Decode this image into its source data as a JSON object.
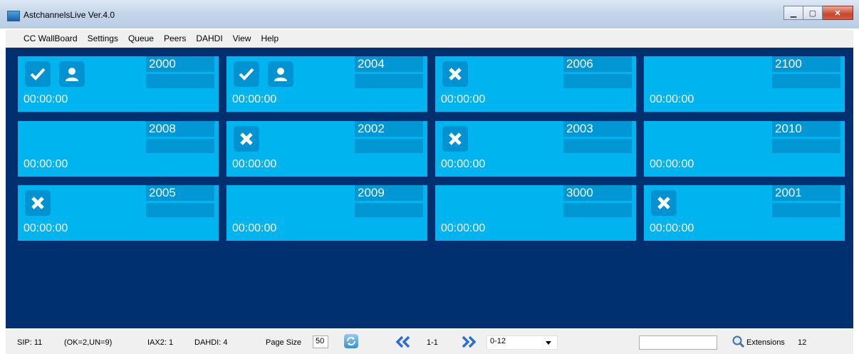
{
  "window": {
    "title": "AstchannelsLive Ver.4.0",
    "icon": "app-icon"
  },
  "menu": {
    "items": [
      "CC WallBoard",
      "Settings",
      "Queue",
      "Peers",
      "DAHDI",
      "View",
      "Help"
    ]
  },
  "tiles": [
    {
      "ext": "2000",
      "time": "00:00:00",
      "icons": [
        "check-icon",
        "user-icon"
      ]
    },
    {
      "ext": "2004",
      "time": "00:00:00",
      "icons": [
        "check-icon",
        "user-icon"
      ]
    },
    {
      "ext": "2006",
      "time": "00:00:00",
      "icons": [
        "x-icon"
      ]
    },
    {
      "ext": "2100",
      "time": "00:00:00",
      "icons": []
    },
    {
      "ext": "2008",
      "time": "00:00:00",
      "icons": []
    },
    {
      "ext": "2002",
      "time": "00:00:00",
      "icons": [
        "x-icon"
      ]
    },
    {
      "ext": "2003",
      "time": "00:00:00",
      "icons": [
        "x-icon"
      ]
    },
    {
      "ext": "2010",
      "time": "00:00:00",
      "icons": []
    },
    {
      "ext": "2005",
      "time": "00:00:00",
      "icons": [
        "x-icon"
      ]
    },
    {
      "ext": "2009",
      "time": "00:00:00",
      "icons": []
    },
    {
      "ext": "3000",
      "time": "00:00:00",
      "icons": []
    },
    {
      "ext": "2001",
      "time": "00:00:00",
      "icons": [
        "x-icon"
      ]
    }
  ],
  "status": {
    "sip": "SIP: 11",
    "ok_un": "(OK=2,UN=9)",
    "iax2": "IAX2: 1",
    "dahdi": "DAHDI: 4",
    "page_size_label": "Page Size",
    "page_size_value": "50",
    "page_range": "1-1",
    "range_select": "0-12",
    "search_value": "",
    "extensions_label": "Extensions",
    "extensions_count": "12"
  },
  "colors": {
    "board_bg": "#003070",
    "tile_bg": "#00b4ef",
    "tile_accent": "#0196d4"
  }
}
